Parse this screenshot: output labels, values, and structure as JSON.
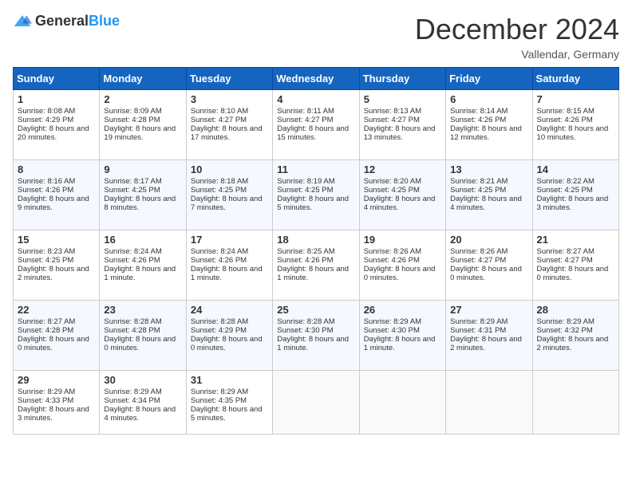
{
  "header": {
    "logo_general": "General",
    "logo_blue": "Blue",
    "title": "December 2024",
    "location": "Vallendar, Germany"
  },
  "weekdays": [
    "Sunday",
    "Monday",
    "Tuesday",
    "Wednesday",
    "Thursday",
    "Friday",
    "Saturday"
  ],
  "weeks": [
    [
      {
        "day": "1",
        "sunrise": "Sunrise: 8:08 AM",
        "sunset": "Sunset: 4:29 PM",
        "daylight": "Daylight: 8 hours and 20 minutes."
      },
      {
        "day": "2",
        "sunrise": "Sunrise: 8:09 AM",
        "sunset": "Sunset: 4:28 PM",
        "daylight": "Daylight: 8 hours and 19 minutes."
      },
      {
        "day": "3",
        "sunrise": "Sunrise: 8:10 AM",
        "sunset": "Sunset: 4:27 PM",
        "daylight": "Daylight: 8 hours and 17 minutes."
      },
      {
        "day": "4",
        "sunrise": "Sunrise: 8:11 AM",
        "sunset": "Sunset: 4:27 PM",
        "daylight": "Daylight: 8 hours and 15 minutes."
      },
      {
        "day": "5",
        "sunrise": "Sunrise: 8:13 AM",
        "sunset": "Sunset: 4:27 PM",
        "daylight": "Daylight: 8 hours and 13 minutes."
      },
      {
        "day": "6",
        "sunrise": "Sunrise: 8:14 AM",
        "sunset": "Sunset: 4:26 PM",
        "daylight": "Daylight: 8 hours and 12 minutes."
      },
      {
        "day": "7",
        "sunrise": "Sunrise: 8:15 AM",
        "sunset": "Sunset: 4:26 PM",
        "daylight": "Daylight: 8 hours and 10 minutes."
      }
    ],
    [
      {
        "day": "8",
        "sunrise": "Sunrise: 8:16 AM",
        "sunset": "Sunset: 4:26 PM",
        "daylight": "Daylight: 8 hours and 9 minutes."
      },
      {
        "day": "9",
        "sunrise": "Sunrise: 8:17 AM",
        "sunset": "Sunset: 4:25 PM",
        "daylight": "Daylight: 8 hours and 8 minutes."
      },
      {
        "day": "10",
        "sunrise": "Sunrise: 8:18 AM",
        "sunset": "Sunset: 4:25 PM",
        "daylight": "Daylight: 8 hours and 7 minutes."
      },
      {
        "day": "11",
        "sunrise": "Sunrise: 8:19 AM",
        "sunset": "Sunset: 4:25 PM",
        "daylight": "Daylight: 8 hours and 5 minutes."
      },
      {
        "day": "12",
        "sunrise": "Sunrise: 8:20 AM",
        "sunset": "Sunset: 4:25 PM",
        "daylight": "Daylight: 8 hours and 4 minutes."
      },
      {
        "day": "13",
        "sunrise": "Sunrise: 8:21 AM",
        "sunset": "Sunset: 4:25 PM",
        "daylight": "Daylight: 8 hours and 4 minutes."
      },
      {
        "day": "14",
        "sunrise": "Sunrise: 8:22 AM",
        "sunset": "Sunset: 4:25 PM",
        "daylight": "Daylight: 8 hours and 3 minutes."
      }
    ],
    [
      {
        "day": "15",
        "sunrise": "Sunrise: 8:23 AM",
        "sunset": "Sunset: 4:25 PM",
        "daylight": "Daylight: 8 hours and 2 minutes."
      },
      {
        "day": "16",
        "sunrise": "Sunrise: 8:24 AM",
        "sunset": "Sunset: 4:26 PM",
        "daylight": "Daylight: 8 hours and 1 minute."
      },
      {
        "day": "17",
        "sunrise": "Sunrise: 8:24 AM",
        "sunset": "Sunset: 4:26 PM",
        "daylight": "Daylight: 8 hours and 1 minute."
      },
      {
        "day": "18",
        "sunrise": "Sunrise: 8:25 AM",
        "sunset": "Sunset: 4:26 PM",
        "daylight": "Daylight: 8 hours and 1 minute."
      },
      {
        "day": "19",
        "sunrise": "Sunrise: 8:26 AM",
        "sunset": "Sunset: 4:26 PM",
        "daylight": "Daylight: 8 hours and 0 minutes."
      },
      {
        "day": "20",
        "sunrise": "Sunrise: 8:26 AM",
        "sunset": "Sunset: 4:27 PM",
        "daylight": "Daylight: 8 hours and 0 minutes."
      },
      {
        "day": "21",
        "sunrise": "Sunrise: 8:27 AM",
        "sunset": "Sunset: 4:27 PM",
        "daylight": "Daylight: 8 hours and 0 minutes."
      }
    ],
    [
      {
        "day": "22",
        "sunrise": "Sunrise: 8:27 AM",
        "sunset": "Sunset: 4:28 PM",
        "daylight": "Daylight: 8 hours and 0 minutes."
      },
      {
        "day": "23",
        "sunrise": "Sunrise: 8:28 AM",
        "sunset": "Sunset: 4:28 PM",
        "daylight": "Daylight: 8 hours and 0 minutes."
      },
      {
        "day": "24",
        "sunrise": "Sunrise: 8:28 AM",
        "sunset": "Sunset: 4:29 PM",
        "daylight": "Daylight: 8 hours and 0 minutes."
      },
      {
        "day": "25",
        "sunrise": "Sunrise: 8:28 AM",
        "sunset": "Sunset: 4:30 PM",
        "daylight": "Daylight: 8 hours and 1 minute."
      },
      {
        "day": "26",
        "sunrise": "Sunrise: 8:29 AM",
        "sunset": "Sunset: 4:30 PM",
        "daylight": "Daylight: 8 hours and 1 minute."
      },
      {
        "day": "27",
        "sunrise": "Sunrise: 8:29 AM",
        "sunset": "Sunset: 4:31 PM",
        "daylight": "Daylight: 8 hours and 2 minutes."
      },
      {
        "day": "28",
        "sunrise": "Sunrise: 8:29 AM",
        "sunset": "Sunset: 4:32 PM",
        "daylight": "Daylight: 8 hours and 2 minutes."
      }
    ],
    [
      {
        "day": "29",
        "sunrise": "Sunrise: 8:29 AM",
        "sunset": "Sunset: 4:33 PM",
        "daylight": "Daylight: 8 hours and 3 minutes."
      },
      {
        "day": "30",
        "sunrise": "Sunrise: 8:29 AM",
        "sunset": "Sunset: 4:34 PM",
        "daylight": "Daylight: 8 hours and 4 minutes."
      },
      {
        "day": "31",
        "sunrise": "Sunrise: 8:29 AM",
        "sunset": "Sunset: 4:35 PM",
        "daylight": "Daylight: 8 hours and 5 minutes."
      },
      null,
      null,
      null,
      null
    ]
  ]
}
